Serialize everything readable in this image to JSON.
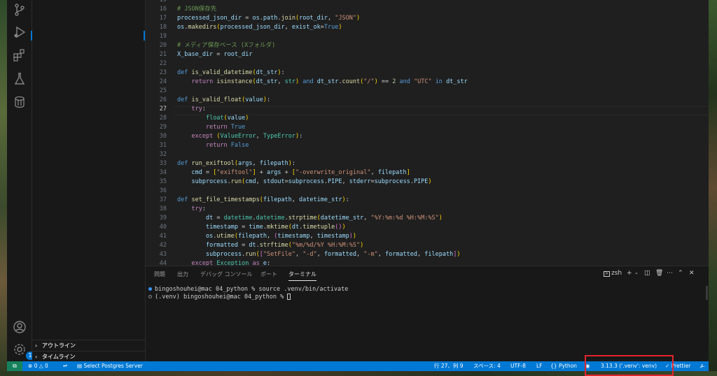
{
  "editor": {
    "lines": [
      {
        "n": "15",
        "tokens": [
          {
            "t": ""
          }
        ]
      },
      {
        "n": "16",
        "tokens": [
          {
            "t": "# JSON保存先",
            "c": "cm"
          }
        ]
      },
      {
        "n": "17",
        "tokens": [
          {
            "t": "processed_json_dir",
            "c": "var"
          },
          {
            "t": " = "
          },
          {
            "t": "os",
            "c": "var"
          },
          {
            "t": "."
          },
          {
            "t": "path",
            "c": "var"
          },
          {
            "t": "."
          },
          {
            "t": "join",
            "c": "fn"
          },
          {
            "t": "(",
            "c": "br1"
          },
          {
            "t": "root_dir",
            "c": "var"
          },
          {
            "t": ", "
          },
          {
            "t": "\"JSON\"",
            "c": "str"
          },
          {
            "t": ")",
            "c": "br1"
          }
        ]
      },
      {
        "n": "18",
        "tokens": [
          {
            "t": "os",
            "c": "var"
          },
          {
            "t": "."
          },
          {
            "t": "makedirs",
            "c": "fn"
          },
          {
            "t": "(",
            "c": "br1"
          },
          {
            "t": "processed_json_dir",
            "c": "var"
          },
          {
            "t": ", "
          },
          {
            "t": "exist_ok",
            "c": "var"
          },
          {
            "t": "="
          },
          {
            "t": "True",
            "c": "kw"
          },
          {
            "t": ")",
            "c": "br1"
          }
        ]
      },
      {
        "n": "19",
        "tokens": [
          {
            "t": ""
          }
        ]
      },
      {
        "n": "20",
        "tokens": [
          {
            "t": "# メディア保存ベース (Xフォルダ)",
            "c": "cm"
          }
        ]
      },
      {
        "n": "21",
        "tokens": [
          {
            "t": "X_base_dir",
            "c": "var"
          },
          {
            "t": " = "
          },
          {
            "t": "root_dir",
            "c": "var"
          }
        ]
      },
      {
        "n": "22",
        "tokens": [
          {
            "t": ""
          }
        ]
      },
      {
        "n": "23",
        "tokens": [
          {
            "t": "def",
            "c": "kw"
          },
          {
            "t": " "
          },
          {
            "t": "is_valid_datetime",
            "c": "fn"
          },
          {
            "t": "(",
            "c": "br1"
          },
          {
            "t": "dt_str",
            "c": "var"
          },
          {
            "t": ")",
            "c": "br1"
          },
          {
            "t": ":"
          }
        ]
      },
      {
        "n": "24",
        "tokens": [
          {
            "t": "    "
          },
          {
            "t": "return",
            "c": "kw2"
          },
          {
            "t": " "
          },
          {
            "t": "isinstance",
            "c": "fn"
          },
          {
            "t": "(",
            "c": "br1"
          },
          {
            "t": "dt_str",
            "c": "var"
          },
          {
            "t": ", "
          },
          {
            "t": "str",
            "c": "cls"
          },
          {
            "t": ")",
            "c": "br1"
          },
          {
            "t": " "
          },
          {
            "t": "and",
            "c": "kw"
          },
          {
            "t": " "
          },
          {
            "t": "dt_str",
            "c": "var"
          },
          {
            "t": "."
          },
          {
            "t": "count",
            "c": "fn"
          },
          {
            "t": "(",
            "c": "br1"
          },
          {
            "t": "\"/\"",
            "c": "str"
          },
          {
            "t": ")",
            "c": "br1"
          },
          {
            "t": " == "
          },
          {
            "t": "2",
            "c": "num"
          },
          {
            "t": " "
          },
          {
            "t": "and",
            "c": "kw"
          },
          {
            "t": " "
          },
          {
            "t": "\"UTC\"",
            "c": "str"
          },
          {
            "t": " "
          },
          {
            "t": "in",
            "c": "kw"
          },
          {
            "t": " "
          },
          {
            "t": "dt_str",
            "c": "var"
          }
        ]
      },
      {
        "n": "25",
        "tokens": [
          {
            "t": ""
          }
        ]
      },
      {
        "n": "26",
        "tokens": [
          {
            "t": "def",
            "c": "kw"
          },
          {
            "t": " "
          },
          {
            "t": "is_valid_float",
            "c": "fn"
          },
          {
            "t": "(",
            "c": "br1"
          },
          {
            "t": "value",
            "c": "var"
          },
          {
            "t": ")",
            "c": "br1"
          },
          {
            "t": ":"
          }
        ]
      },
      {
        "n": "27",
        "tokens": [
          {
            "t": "    "
          },
          {
            "t": "try",
            "c": "kw2"
          },
          {
            "t": ":"
          }
        ]
      },
      {
        "n": "28",
        "tokens": [
          {
            "t": "        "
          },
          {
            "t": "float",
            "c": "cls"
          },
          {
            "t": "(",
            "c": "br1"
          },
          {
            "t": "value",
            "c": "var"
          },
          {
            "t": ")",
            "c": "br1"
          }
        ]
      },
      {
        "n": "29",
        "tokens": [
          {
            "t": "        "
          },
          {
            "t": "return",
            "c": "kw2"
          },
          {
            "t": " "
          },
          {
            "t": "True",
            "c": "kw"
          }
        ]
      },
      {
        "n": "30",
        "tokens": [
          {
            "t": "    "
          },
          {
            "t": "except",
            "c": "kw2"
          },
          {
            "t": " "
          },
          {
            "t": "(",
            "c": "br1"
          },
          {
            "t": "ValueError",
            "c": "cls"
          },
          {
            "t": ", "
          },
          {
            "t": "TypeError",
            "c": "cls"
          },
          {
            "t": ")",
            "c": "br1"
          },
          {
            "t": ":"
          }
        ]
      },
      {
        "n": "31",
        "tokens": [
          {
            "t": "        "
          },
          {
            "t": "return",
            "c": "kw2"
          },
          {
            "t": " "
          },
          {
            "t": "False",
            "c": "kw"
          }
        ]
      },
      {
        "n": "32",
        "tokens": [
          {
            "t": ""
          }
        ]
      },
      {
        "n": "33",
        "tokens": [
          {
            "t": "def",
            "c": "kw"
          },
          {
            "t": " "
          },
          {
            "t": "run_exiftool",
            "c": "fn"
          },
          {
            "t": "(",
            "c": "br1"
          },
          {
            "t": "args",
            "c": "var"
          },
          {
            "t": ", "
          },
          {
            "t": "filepath",
            "c": "var"
          },
          {
            "t": ")",
            "c": "br1"
          },
          {
            "t": ":"
          }
        ]
      },
      {
        "n": "34",
        "tokens": [
          {
            "t": "    "
          },
          {
            "t": "cmd",
            "c": "var"
          },
          {
            "t": " = "
          },
          {
            "t": "[",
            "c": "br1"
          },
          {
            "t": "\"exiftool\"",
            "c": "str"
          },
          {
            "t": "]",
            "c": "br1"
          },
          {
            "t": " + "
          },
          {
            "t": "args",
            "c": "var"
          },
          {
            "t": " + "
          },
          {
            "t": "[",
            "c": "br1"
          },
          {
            "t": "\"-overwrite_original\"",
            "c": "str"
          },
          {
            "t": ", "
          },
          {
            "t": "filepath",
            "c": "var"
          },
          {
            "t": "]",
            "c": "br1"
          }
        ]
      },
      {
        "n": "35",
        "tokens": [
          {
            "t": "    "
          },
          {
            "t": "subprocess",
            "c": "var"
          },
          {
            "t": "."
          },
          {
            "t": "run",
            "c": "fn"
          },
          {
            "t": "(",
            "c": "br1"
          },
          {
            "t": "cmd",
            "c": "var"
          },
          {
            "t": ", "
          },
          {
            "t": "stdout",
            "c": "var"
          },
          {
            "t": "="
          },
          {
            "t": "subprocess",
            "c": "var"
          },
          {
            "t": "."
          },
          {
            "t": "PIPE",
            "c": "var"
          },
          {
            "t": ", "
          },
          {
            "t": "stderr",
            "c": "var"
          },
          {
            "t": "="
          },
          {
            "t": "subprocess",
            "c": "var"
          },
          {
            "t": "."
          },
          {
            "t": "PIPE",
            "c": "var"
          },
          {
            "t": ")",
            "c": "br1"
          }
        ]
      },
      {
        "n": "36",
        "tokens": [
          {
            "t": ""
          }
        ]
      },
      {
        "n": "37",
        "tokens": [
          {
            "t": "def",
            "c": "kw"
          },
          {
            "t": " "
          },
          {
            "t": "set_file_timestamps",
            "c": "fn"
          },
          {
            "t": "(",
            "c": "br1"
          },
          {
            "t": "filepath",
            "c": "var"
          },
          {
            "t": ", "
          },
          {
            "t": "datetime_str",
            "c": "var"
          },
          {
            "t": ")",
            "c": "br1"
          },
          {
            "t": ":"
          }
        ]
      },
      {
        "n": "38",
        "tokens": [
          {
            "t": "    "
          },
          {
            "t": "try",
            "c": "kw2"
          },
          {
            "t": ":"
          }
        ]
      },
      {
        "n": "39",
        "tokens": [
          {
            "t": "        "
          },
          {
            "t": "dt",
            "c": "var"
          },
          {
            "t": " = "
          },
          {
            "t": "datetime",
            "c": "cls"
          },
          {
            "t": "."
          },
          {
            "t": "datetime",
            "c": "cls"
          },
          {
            "t": "."
          },
          {
            "t": "strptime",
            "c": "fn"
          },
          {
            "t": "(",
            "c": "br1"
          },
          {
            "t": "datetime_str",
            "c": "var"
          },
          {
            "t": ", "
          },
          {
            "t": "\"%Y:%m:%d %H:%M:%S\"",
            "c": "str"
          },
          {
            "t": ")",
            "c": "br1"
          }
        ]
      },
      {
        "n": "40",
        "tokens": [
          {
            "t": "        "
          },
          {
            "t": "timestamp",
            "c": "var"
          },
          {
            "t": " = "
          },
          {
            "t": "time",
            "c": "var"
          },
          {
            "t": "."
          },
          {
            "t": "mktime",
            "c": "fn"
          },
          {
            "t": "(",
            "c": "br1"
          },
          {
            "t": "dt",
            "c": "var"
          },
          {
            "t": "."
          },
          {
            "t": "timetuple",
            "c": "fn"
          },
          {
            "t": "()",
            "c": "br2"
          },
          {
            "t": ")",
            "c": "br1"
          }
        ]
      },
      {
        "n": "41",
        "tokens": [
          {
            "t": "        "
          },
          {
            "t": "os",
            "c": "var"
          },
          {
            "t": "."
          },
          {
            "t": "utime",
            "c": "fn"
          },
          {
            "t": "(",
            "c": "br1"
          },
          {
            "t": "filepath",
            "c": "var"
          },
          {
            "t": ", "
          },
          {
            "t": "(",
            "c": "br2"
          },
          {
            "t": "timestamp",
            "c": "var"
          },
          {
            "t": ", "
          },
          {
            "t": "timestamp",
            "c": "var"
          },
          {
            "t": ")",
            "c": "br2"
          },
          {
            "t": ")",
            "c": "br1"
          }
        ]
      },
      {
        "n": "42",
        "tokens": [
          {
            "t": "        "
          },
          {
            "t": "formatted",
            "c": "var"
          },
          {
            "t": " = "
          },
          {
            "t": "dt",
            "c": "var"
          },
          {
            "t": "."
          },
          {
            "t": "strftime",
            "c": "fn"
          },
          {
            "t": "(",
            "c": "br1"
          },
          {
            "t": "\"%m/%d/%Y %H:%M:%S\"",
            "c": "str"
          },
          {
            "t": ")",
            "c": "br1"
          }
        ]
      },
      {
        "n": "43",
        "tokens": [
          {
            "t": "        "
          },
          {
            "t": "subprocess",
            "c": "var"
          },
          {
            "t": "."
          },
          {
            "t": "run",
            "c": "fn"
          },
          {
            "t": "(",
            "c": "br1"
          },
          {
            "t": "[",
            "c": "br2"
          },
          {
            "t": "\"SetFile\"",
            "c": "str"
          },
          {
            "t": ", "
          },
          {
            "t": "\"-d\"",
            "c": "str"
          },
          {
            "t": ", "
          },
          {
            "t": "formatted",
            "c": "var"
          },
          {
            "t": ", "
          },
          {
            "t": "\"-m\"",
            "c": "str"
          },
          {
            "t": ", "
          },
          {
            "t": "formatted",
            "c": "var"
          },
          {
            "t": ", "
          },
          {
            "t": "filepath",
            "c": "var"
          },
          {
            "t": "]",
            "c": "br2"
          },
          {
            "t": ")",
            "c": "br1"
          }
        ]
      },
      {
        "n": "44",
        "tokens": [
          {
            "t": "    "
          },
          {
            "t": "except",
            "c": "kw2"
          },
          {
            "t": " "
          },
          {
            "t": "Exception",
            "c": "cls"
          },
          {
            "t": " "
          },
          {
            "t": "as",
            "c": "kw2"
          },
          {
            "t": " "
          },
          {
            "t": "e",
            "c": "var"
          },
          {
            "t": ":"
          }
        ]
      }
    ],
    "active_line": "27"
  },
  "sidebar": {
    "outline_label": "アウトライン",
    "timeline_label": "タイムライン"
  },
  "activity_bar": {
    "badge": "1"
  },
  "panel": {
    "tabs": [
      "問題",
      "出力",
      "デバッグ コンソール",
      "ポート",
      "ターミナル"
    ],
    "active_tab": "ターミナル",
    "shell_label": "zsh",
    "terminal_lines": [
      {
        "text": "bingoshouhei@mac 04_python % source .venv/bin/activate",
        "dot": "blue"
      },
      {
        "text": "(.venv) bingoshouhei@mac 04_python % ",
        "dot": "hollow"
      }
    ]
  },
  "statusbar": {
    "errors": "0",
    "warnings": "0",
    "postgres": "Select Postgres Server",
    "position": "行 27、列 9",
    "spaces": "スペース: 4",
    "encoding": "UTF-8",
    "eol": "LF",
    "language": "Python",
    "interpreter": "3.13.3 ('.venv': venv)",
    "prettier": "Prettier"
  },
  "colors": {
    "statusbar": "#0078d4",
    "remote": "#16825d",
    "highlight": "#e3242b",
    "editor_bg": "#1f1f1f"
  }
}
